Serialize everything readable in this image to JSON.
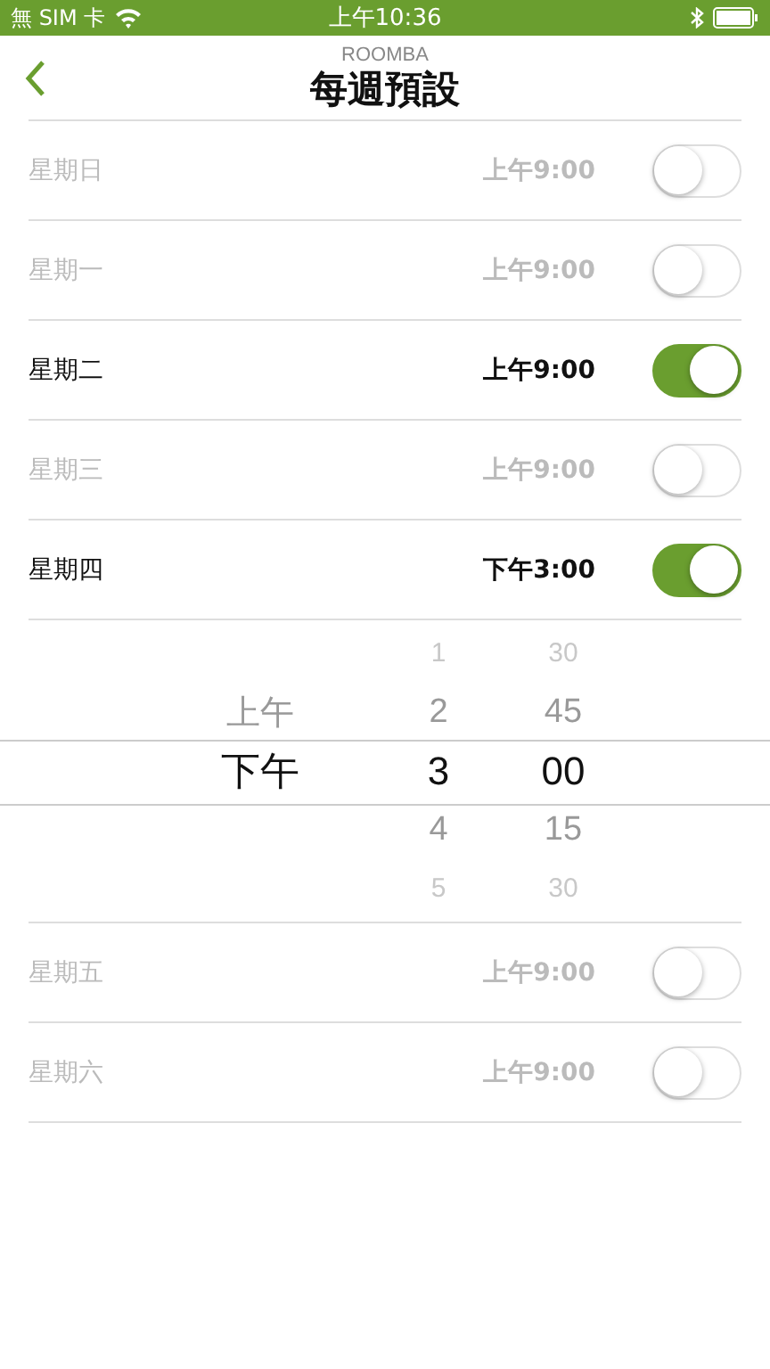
{
  "status_bar": {
    "carrier": "無 SIM 卡",
    "time": "上午10:36"
  },
  "header": {
    "app_name": "ROOMBA",
    "title": "每週預設"
  },
  "days": [
    {
      "day": "星期日",
      "time": "上午9:00",
      "on": false
    },
    {
      "day": "星期一",
      "time": "上午9:00",
      "on": false
    },
    {
      "day": "星期二",
      "time": "上午9:00",
      "on": true
    },
    {
      "day": "星期三",
      "time": "上午9:00",
      "on": false
    },
    {
      "day": "星期四",
      "time": "下午3:00",
      "on": true,
      "expanded": true
    },
    {
      "day": "星期五",
      "time": "上午9:00",
      "on": false
    },
    {
      "day": "星期六",
      "time": "上午9:00",
      "on": false
    }
  ],
  "picker": {
    "columns": [
      {
        "items": [
          {
            "text": "上午",
            "selected": false
          },
          {
            "text": "下午",
            "selected": true
          }
        ]
      },
      {
        "items": [
          {
            "text": "1",
            "selected": false
          },
          {
            "text": "2",
            "selected": false
          },
          {
            "text": "3",
            "selected": true
          },
          {
            "text": "4",
            "selected": false
          },
          {
            "text": "5",
            "selected": false
          }
        ]
      },
      {
        "items": [
          {
            "text": "30",
            "selected": false
          },
          {
            "text": "45",
            "selected": false
          },
          {
            "text": "00",
            "selected": true
          },
          {
            "text": "15",
            "selected": false
          },
          {
            "text": "30",
            "selected": false
          }
        ]
      }
    ]
  }
}
